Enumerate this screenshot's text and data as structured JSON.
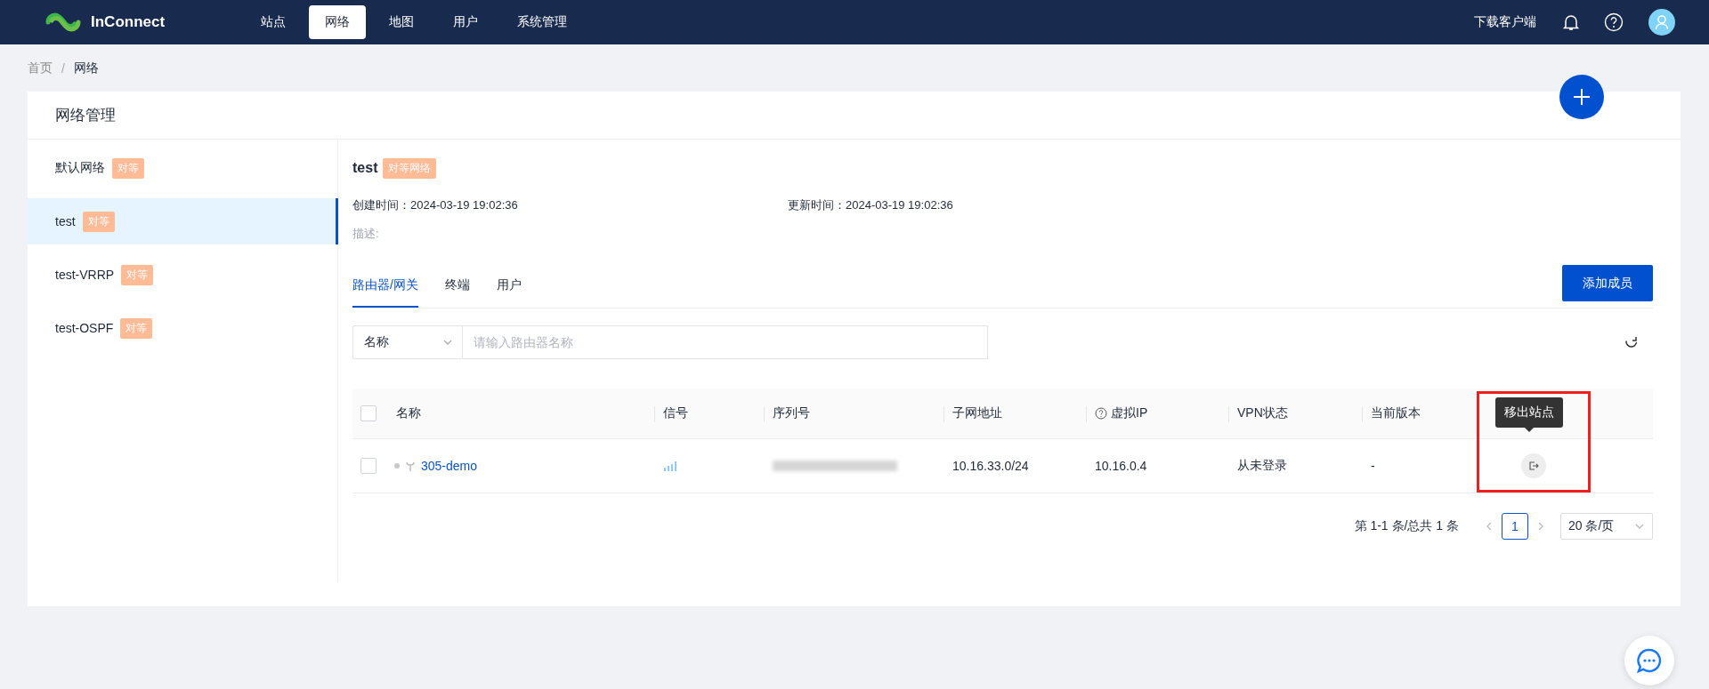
{
  "header": {
    "logo": "InConnect",
    "nav": [
      {
        "label": "站点",
        "selected": false
      },
      {
        "label": "网络",
        "selected": true
      },
      {
        "label": "地图",
        "selected": false
      },
      {
        "label": "用户",
        "selected": false
      },
      {
        "label": "系统管理",
        "selected": false
      }
    ],
    "download": "下载客户端"
  },
  "breadcrumb": [
    "首页",
    "网络"
  ],
  "breadcrumb_separator": "/",
  "card": {
    "title": "网络管理"
  },
  "networks": [
    {
      "name": "默认网络",
      "tag": "对等",
      "selected": false
    },
    {
      "name": "test",
      "tag": "对等",
      "selected": true
    },
    {
      "name": "test-VRRP",
      "tag": "对等",
      "selected": false
    },
    {
      "name": "test-OSPF",
      "tag": "对等",
      "selected": false
    }
  ],
  "detail": {
    "name": "test",
    "tag": "对等网络",
    "created_label": "创建时间：",
    "created": "2024-03-19 19:02:36",
    "updated_label": "更新时间：",
    "updated": "2024-03-19 19:02:36",
    "description_label": "描述:"
  },
  "tabs": [
    {
      "label": "路由器/网关",
      "selected": true
    },
    {
      "label": "终端",
      "selected": false
    },
    {
      "label": "用户",
      "selected": false
    }
  ],
  "add_button": "添加成员",
  "search": {
    "field": "名称",
    "placeholder": "请输入路由器名称"
  },
  "table": {
    "select_all": false,
    "columns": [
      {
        "label": "名称",
        "help": false
      },
      {
        "label": "信号",
        "help": false
      },
      {
        "label": "序列号",
        "help": false
      },
      {
        "label": "子网地址",
        "help": false
      },
      {
        "label": "虚拟IP",
        "help": true
      },
      {
        "label": "VPN状态",
        "help": false
      },
      {
        "label": "当前版本",
        "help": false
      }
    ],
    "rows": [
      {
        "checked": false,
        "name": "305-demo",
        "subnet": "10.16.33.0/24",
        "virtual_ip": "10.16.0.4",
        "vpn_status": "从未登录",
        "version": "-"
      }
    ]
  },
  "tooltip": "移出站点",
  "pagination": {
    "summary": "第 1-1 条/总共 1 条",
    "pages": [
      {
        "label": "1",
        "selected": true
      }
    ],
    "page_size": "20 条/页"
  }
}
